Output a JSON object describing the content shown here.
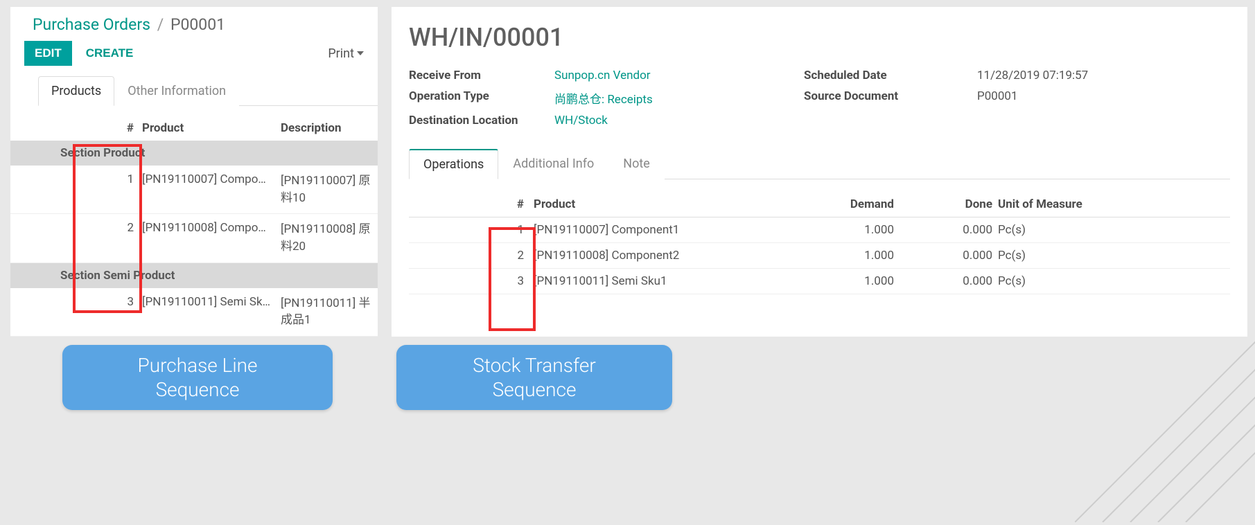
{
  "po": {
    "breadcrumb": {
      "root": "Purchase Orders",
      "sep": "/",
      "current": "P00001"
    },
    "buttons": {
      "edit": "EDIT",
      "create": "CREATE",
      "print": "Print"
    },
    "tabs": {
      "products": "Products",
      "other": "Other Information"
    },
    "headers": {
      "num": "#",
      "product": "Product",
      "desc": "Description"
    },
    "sections": [
      {
        "title": "Section Product",
        "rows": [
          {
            "n": "1",
            "product": "[PN19110007] Compo…",
            "desc": "[PN19110007] 原料10"
          },
          {
            "n": "2",
            "product": "[PN19110008] Compo…",
            "desc": "[PN19110008] 原料20"
          }
        ]
      },
      {
        "title": "Section Semi Product",
        "rows": [
          {
            "n": "3",
            "product": "[PN19110011] Semi Sk…",
            "desc": "[PN19110011] 半成品1"
          }
        ]
      }
    ]
  },
  "transfer": {
    "title": "WH/IN/00001",
    "fields": {
      "receive_from_label": "Receive From",
      "receive_from": "Sunpop.cn Vendor",
      "op_type_label": "Operation Type",
      "op_type": "尚鹏总仓: Receipts",
      "dest_label": "Destination Location",
      "dest": "WH/Stock",
      "sched_label": "Scheduled Date",
      "sched": "11/28/2019 07:19:57",
      "source_label": "Source Document",
      "source": "P00001"
    },
    "tabs": {
      "ops": "Operations",
      "addl": "Additional Info",
      "note": "Note"
    },
    "headers": {
      "num": "#",
      "product": "Product",
      "demand": "Demand",
      "done": "Done",
      "uom": "Unit of Measure"
    },
    "rows": [
      {
        "n": "1",
        "product": "[PN19110007] Component1",
        "demand": "1.000",
        "done": "0.000",
        "uom": "Pc(s)"
      },
      {
        "n": "2",
        "product": "[PN19110008] Component2",
        "demand": "1.000",
        "done": "0.000",
        "uom": "Pc(s)"
      },
      {
        "n": "3",
        "product": "[PN19110011] Semi Sku1",
        "demand": "1.000",
        "done": "0.000",
        "uom": "Pc(s)"
      }
    ]
  },
  "callouts": {
    "left_line1": "Purchase Line",
    "left_line2": "Sequence",
    "right_line1": "Stock Transfer",
    "right_line2": "Sequence"
  }
}
